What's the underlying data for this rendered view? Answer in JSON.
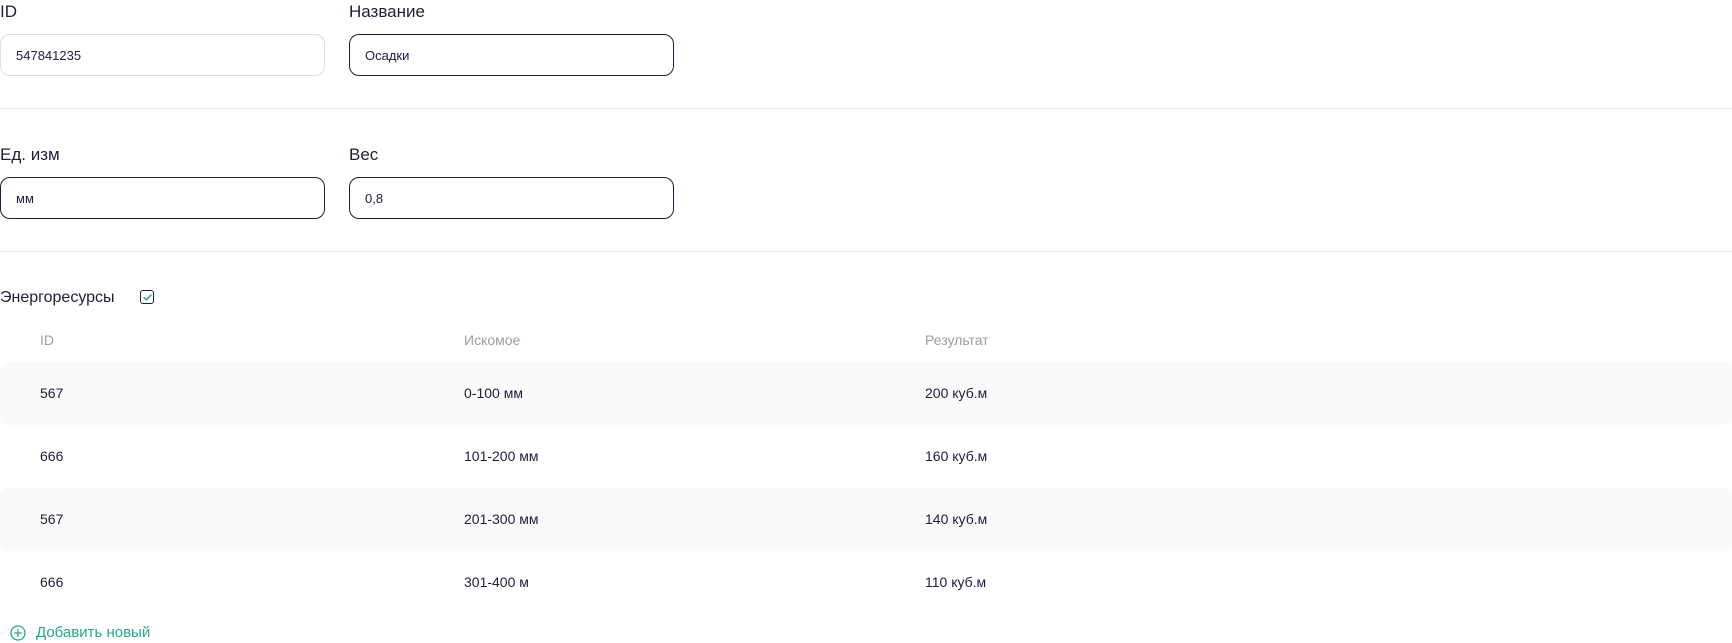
{
  "form": {
    "id_label": "ID",
    "id_value": "547841235",
    "name_label": "Название",
    "name_value": "Осадки",
    "unit_label": "Ед. изм",
    "unit_value": "мм",
    "weight_label": "Вес",
    "weight_value": "0,8"
  },
  "section": {
    "title": "Энергоресурсы",
    "checked": true,
    "icon": "checkbox-checked-icon"
  },
  "table": {
    "headers": [
      "ID",
      "Искомое",
      "Результат"
    ],
    "rows": [
      [
        "567",
        "0-100 мм",
        "200 куб.м"
      ],
      [
        "666",
        "101-200 мм",
        "160 куб.м"
      ],
      [
        "567",
        "201-300 мм",
        "140 куб.м"
      ],
      [
        "666",
        "301-400 м",
        "110 куб.м"
      ]
    ]
  },
  "actions": {
    "add_new_label": "Добавить новый",
    "add_new_icon": "plus-circle-icon"
  },
  "colors": {
    "text": "#1f1d3a",
    "muted": "#9a9cab",
    "accent": "#21a98a",
    "row_shade": "#fafafb"
  }
}
